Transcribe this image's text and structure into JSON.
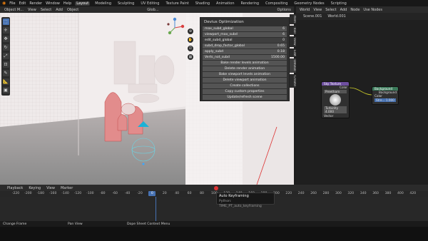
{
  "topbar": {
    "menus": [
      "File",
      "Edit",
      "Render",
      "Window",
      "Help"
    ],
    "tabs": [
      "Layout",
      "Modeling",
      "Sculpting",
      "UV Editing",
      "Texture Paint",
      "Shading",
      "Animation",
      "Rendering",
      "Compositing",
      "Geometry Nodes",
      "Scripting"
    ],
    "active_tab": "Layout",
    "scene": "Scene.001",
    "view_layer": "World.001"
  },
  "viewport_header": {
    "mode": "Object M...",
    "menus": [
      "View",
      "Select",
      "Add",
      "Object"
    ],
    "transform": "Glob..."
  },
  "sidebar_tabs": [
    "Item",
    "Tool",
    "View",
    "Edit",
    "Devius",
    "Create"
  ],
  "devius": {
    "title": "Devius Optimization",
    "properties": [
      {
        "label": "max_subd_global",
        "value": "6"
      },
      {
        "label": "viewport_max_subd",
        "value": "6"
      },
      {
        "label": "edit_subd_global",
        "value": "0"
      },
      {
        "label": "subd_drop_factor_global",
        "value": "0.65"
      },
      {
        "label": "apply_subd",
        "value": "0.18"
      },
      {
        "label": "Verts_not_subd",
        "value": "1500.00"
      }
    ],
    "buttons": [
      "Bake render levels animation",
      "Delete render animation",
      "Bake viewport levels animation",
      "Delete viewport animation",
      "Create collections",
      "Copy custom properties",
      "Update/refresh scene"
    ]
  },
  "node_editor": {
    "header_menus": [
      "View",
      "Select",
      "Add",
      "Node"
    ],
    "use_nodes": "Use Nodes",
    "world": "World",
    "options": "Options",
    "breadcrumbs": [
      "Scene.001",
      "World.001"
    ],
    "sky_node": {
      "title": "Sky Texture",
      "type": "Preetham",
      "turbidity": "Turbidity 4.000",
      "out": "Color",
      "in": "Vector"
    },
    "bg_node": {
      "title": "Background",
      "out": "Background",
      "color": "Color",
      "strength": "Stre... 1.000"
    }
  },
  "timeline": {
    "menus": [
      "Playback",
      "Keying",
      "View",
      "Marker"
    ],
    "current_frame": "0",
    "ticks": [
      "-220",
      "-200",
      "-180",
      "-160",
      "-140",
      "-120",
      "-100",
      "-80",
      "-60",
      "-40",
      "-20",
      "0",
      "20",
      "40",
      "60",
      "80",
      "100",
      "120",
      "140",
      "160",
      "180",
      "200",
      "220",
      "240",
      "260",
      "280",
      "300",
      "320",
      "340",
      "360",
      "380",
      "400",
      "420"
    ]
  },
  "tooltip": {
    "title": "Auto Keyframing",
    "python": "Python: TIME_PT_auto_keyframing"
  },
  "status_bar": {
    "left": "Change Frame",
    "middle": "Pan View",
    "right": "Dope Sheet Context Menu"
  }
}
